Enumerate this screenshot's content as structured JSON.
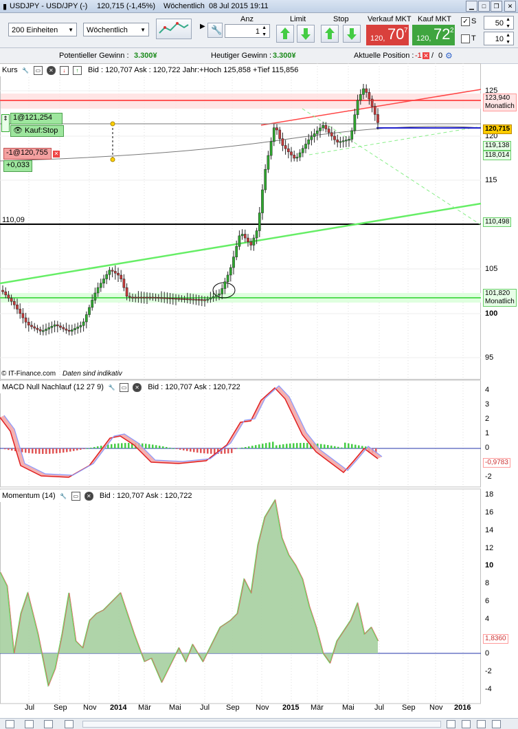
{
  "window": {
    "title": "USDJPY - USD/JPY (-)",
    "quote": "120,715 (-1,45%)",
    "period": "Wöchentlich",
    "datetime": "08 Jul 2015 19:11"
  },
  "toolbar": {
    "units": "200 Einheiten",
    "timeframe": "Wöchentlich",
    "anz_label": "Anz",
    "anz_value": "1",
    "limit_label": "Limit",
    "stop_label": "Stop",
    "sell_label": "Verkauf MKT",
    "buy_label": "Kauf MKT",
    "sell_price": {
      "prefix": "120,",
      "big": "70",
      "sup": "7"
    },
    "buy_price": {
      "prefix": "120,",
      "big": "72",
      "sup": "2"
    },
    "s_label": "S",
    "s_value": "50",
    "t_label": "T",
    "t_value": "10"
  },
  "infobar": {
    "potential_label": "Potentieller Gewinn :",
    "potential_value": "3.300¥",
    "today_label": "Heutiger Gewinn :",
    "today_value": "3.300¥",
    "position_label": "Aktuelle Position :",
    "position_value": "-1",
    "position_zero": "0"
  },
  "price_panel": {
    "title": "Kurs",
    "info": "Bid : 120,707 Ask : 120,722 Jahr:+Hoch 125,858 +Tief 115,856",
    "y_labels": [
      "125",
      "120",
      "115",
      "110",
      "105",
      "100",
      "95"
    ],
    "level_110": "110,09",
    "tag_top": "123,940",
    "tag_top_sub": "Monatlich",
    "tag_current": "120,715",
    "tag_g1": "119,138",
    "tag_g2": "118,014",
    "tag_110": "110,498",
    "tag_101": "101,820",
    "tag_101_sub": "Monatlich",
    "order1": "1@121,254",
    "order1_sub": "Kauf:Stop",
    "order2": "-1@120,755",
    "order2_sub": "+0,033",
    "copyright": "© IT-Finance.com",
    "indicative": "Daten sind indikativ"
  },
  "macd_panel": {
    "title": "MACD Null Nachlauf (12 27 9)",
    "info": "Bid : 120,707 Ask : 120,722",
    "y_labels": [
      "4",
      "3",
      "2",
      "1",
      "0",
      "-1",
      "-2"
    ],
    "tag1": "-0,9783"
  },
  "momentum_panel": {
    "title": "Momentum (14)",
    "info": "Bid : 120,707 Ask : 120,722",
    "y_labels": [
      "18",
      "16",
      "14",
      "12",
      "10",
      "8",
      "6",
      "4",
      "2",
      "0",
      "-2",
      "-4"
    ],
    "tag": "1,8360"
  },
  "x_axis": [
    "Jul",
    "Sep",
    "Nov",
    "2014",
    "Mär",
    "Mai",
    "Jul",
    "Sep",
    "Nov",
    "2015",
    "Mär",
    "Mai",
    "Jul",
    "Sep",
    "Nov",
    "2016"
  ],
  "colors": {
    "sell": "#d9403c",
    "buy": "#3fa53f",
    "support": "#66dd66",
    "resistance": "#ff4444"
  }
}
